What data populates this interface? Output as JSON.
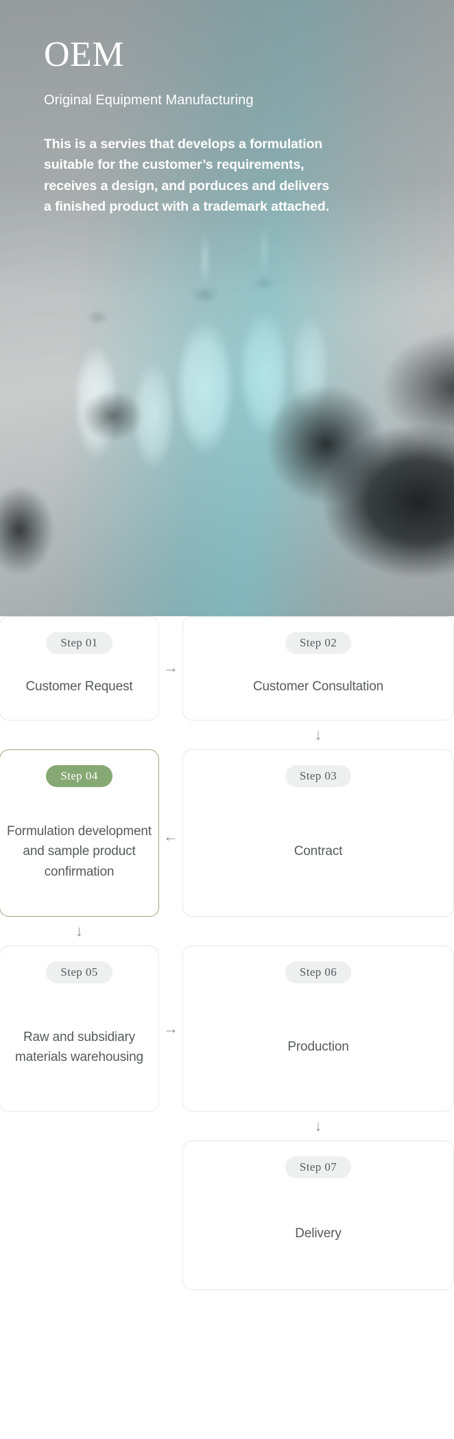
{
  "hero": {
    "title": "OEM",
    "subtitle": "Original Equipment Manufacturing",
    "description_lines": [
      "This is a servies that develops a formulation",
      "suitable for the customer’s requirements,",
      "receives a design, and porduces and delivers",
      "a finished product with a trademark attached."
    ]
  },
  "colors": {
    "accent_green": "#86a873",
    "accent_green_border": "#93ab78",
    "badge_grey_bg": "#eeefef",
    "card_border": "#e6e7e7",
    "text_grey": "#555a5c",
    "arrow_grey": "#8d9294",
    "hero_text": "#ffffff"
  },
  "flow": {
    "rows": [
      {
        "left": {
          "step": "Step 01",
          "label": "Customer Request",
          "active": false,
          "empty": false
        },
        "right": {
          "step": "Step 02",
          "label": "Customer Consultation",
          "active": false,
          "empty": false
        },
        "h_arrow": {
          "glyph": "→",
          "name": "arrow-right-icon",
          "direction": "right"
        },
        "connector": {
          "glyph": "↓",
          "name": "arrow-down-icon",
          "column": "right"
        }
      },
      {
        "left": {
          "step": "Step 04",
          "label": "Formulation development and sample product confirmation",
          "active": true,
          "empty": false
        },
        "right": {
          "step": "Step 03",
          "label": "Contract",
          "active": false,
          "empty": false
        },
        "h_arrow": {
          "glyph": "←",
          "name": "arrow-left-icon",
          "direction": "left"
        },
        "connector": {
          "glyph": "↓",
          "name": "arrow-down-icon",
          "column": "left"
        }
      },
      {
        "left": {
          "step": "Step 05",
          "label": "Raw and subsidiary materials warehousing",
          "active": false,
          "empty": false
        },
        "right": {
          "step": "Step 06",
          "label": "Production",
          "active": false,
          "empty": false
        },
        "h_arrow": {
          "glyph": "→",
          "name": "arrow-right-icon",
          "direction": "right"
        },
        "connector": {
          "glyph": "↓",
          "name": "arrow-down-icon",
          "column": "right"
        }
      },
      {
        "left": {
          "step": "",
          "label": "",
          "active": false,
          "empty": true
        },
        "right": {
          "step": "Step 07",
          "label": "Delivery",
          "active": false,
          "empty": false
        },
        "h_arrow": null,
        "connector": null
      }
    ]
  }
}
